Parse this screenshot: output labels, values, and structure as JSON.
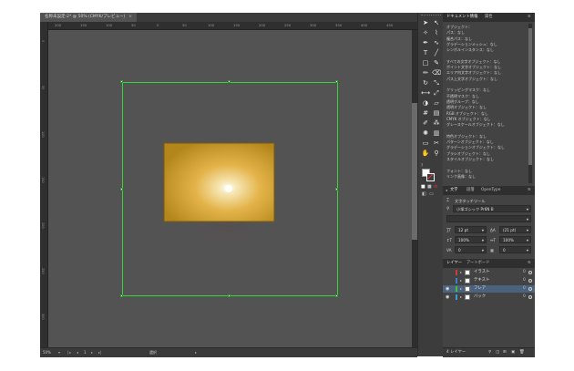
{
  "document": {
    "tab_title": "名称未設定-2* @ 50% (CMYK/プレビュー)",
    "tab_close": "×"
  },
  "ruler": {
    "h_ticks": [
      "200",
      "150",
      "100",
      "50",
      "0",
      "50",
      "100",
      "150",
      "200",
      "250",
      "300",
      "350",
      "400",
      "450"
    ],
    "v_ticks": [
      "0",
      "50",
      "100",
      "150",
      "200",
      "250",
      "300"
    ]
  },
  "status": {
    "zoom": "50%",
    "page": "1",
    "tool_name": "選択"
  },
  "tools": {
    "icons": [
      "selection-arrow",
      "direct-selection",
      "magic-wand",
      "lasso",
      "pen",
      "curvature",
      "type",
      "line",
      "rectangle",
      "paintbrush",
      "pencil",
      "eraser",
      "rotate",
      "scale",
      "width",
      "free-transform",
      "shape-builder",
      "perspective",
      "mesh",
      "gradient",
      "eyedropper",
      "blend",
      "symbol-sprayer",
      "graph",
      "artboard",
      "slice",
      "hand",
      "zoom"
    ],
    "glyphs": [
      "➤",
      "↖",
      "✧",
      "⌇",
      "✒",
      "∿",
      "T",
      "╱",
      "□",
      "✎",
      "✏",
      "⌫",
      "↻",
      "⤡",
      "⟷",
      "⤢",
      "◑",
      "▱",
      "#",
      "▤",
      "✐",
      "⁂",
      "✺",
      "▥",
      "▭",
      "✂",
      "✋",
      "⚲"
    ],
    "fill_stroke_question": "?"
  },
  "doc_info_panel": {
    "tabs": [
      "ドキュメント情報",
      "属性"
    ],
    "menu_icon": "≡",
    "lines": [
      "オブジェクト：",
      "パス：なし",
      "複合パス：なし",
      "グラデーションメッシュ：なし",
      "シンボルインスタンス：なし",
      "",
      "すべての文字オブジェクト：なし",
      "ポイント文字オブジェクト：なし",
      "エリア内文字オブジェクト：なし",
      "パス上文字オブジェクト：なし",
      "",
      "クリッピングマスク：なし",
      "不透明マスク：なし",
      "透明グループ：なし",
      "透明オブジェクト：なし",
      "RGB オブジェクト：なし",
      "CMYK オブジェクト：なし",
      "グレースケールオブジェクト：なし",
      "",
      "特色オブジェクト：なし",
      "パターンオブジェクト：なし",
      "グラデーションオブジェクト：なし",
      "ブラシオブジェクト：なし",
      "スタイルオブジェクト：なし",
      "",
      "フォント：なし",
      "リンク画像：なし"
    ]
  },
  "character_panel": {
    "tabs": [
      "文字",
      "段落",
      "OpenType"
    ],
    "menu_icon": "≡",
    "touch_tool_label": "文字タッチツール",
    "font_family": "小塚ゴシック Pr6N B",
    "font_style": "",
    "font_size": "12 pt",
    "leading": "(21 pt)",
    "vertical_scale": "100%",
    "horizontal_scale": "100%",
    "tracking": "0",
    "kerning": "0"
  },
  "layers_panel": {
    "tabs": [
      "レイヤー",
      "アートボード"
    ],
    "menu_icon": "≡",
    "layers": [
      {
        "name": "イラスト",
        "count": "0",
        "color": "#d23a3a",
        "visible": false,
        "selected": false
      },
      {
        "name": "テキスト",
        "count": "0",
        "color": "#3a7fd2",
        "visible": false,
        "selected": false
      },
      {
        "name": "フレア",
        "count": "0",
        "color": "#3ac24a",
        "visible": true,
        "selected": true
      },
      {
        "name": "バック",
        "count": "0",
        "color": "#3a9ad2",
        "visible": true,
        "selected": false
      }
    ],
    "footer_label": "4 レイヤー"
  },
  "colors": {
    "artboard_guide": "#35d43a",
    "rect_fill_center": "#ffffff",
    "rect_fill_mid": "#e4b44a",
    "rect_fill_edge": "#b3861c",
    "rect_stroke": "#7a5a10",
    "selection_blue": "#4b627d"
  }
}
